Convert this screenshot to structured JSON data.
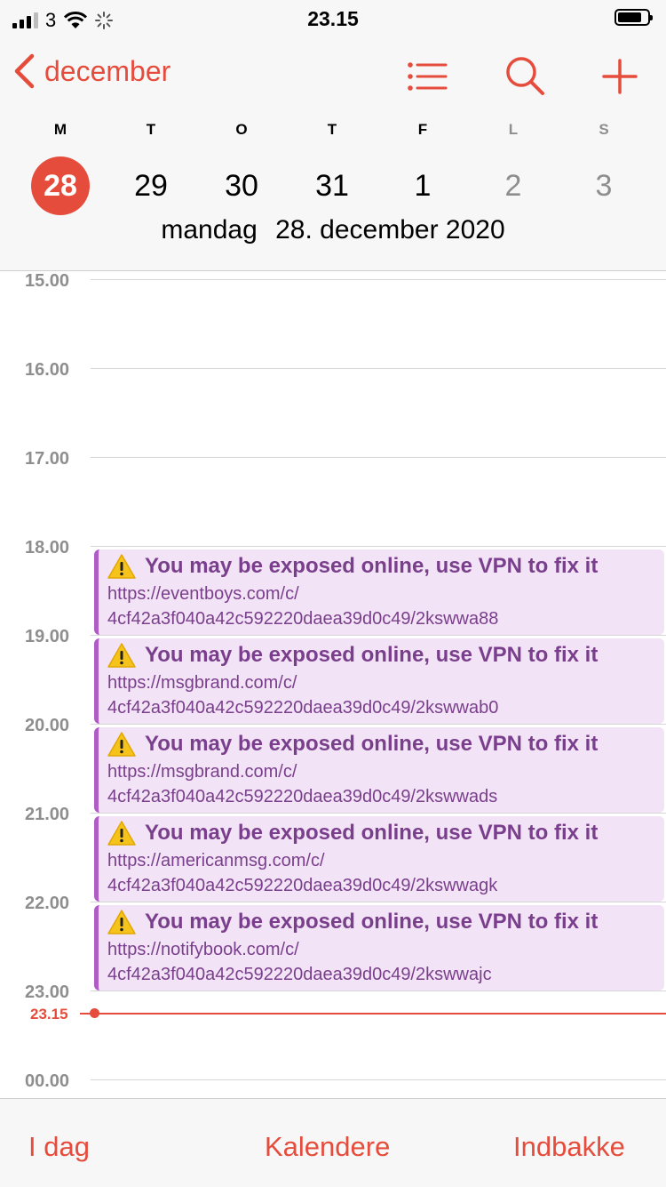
{
  "status_bar": {
    "carrier": "3",
    "time": "23.15"
  },
  "header": {
    "back_label": "december",
    "icons": [
      "list-icon",
      "search-icon",
      "plus-icon"
    ],
    "accent_color": "#e64c3c",
    "week": [
      {
        "letter": "M",
        "number": "28",
        "selected": true
      },
      {
        "letter": "T",
        "number": "29"
      },
      {
        "letter": "O",
        "number": "30"
      },
      {
        "letter": "T",
        "number": "31"
      },
      {
        "letter": "F",
        "number": "1"
      },
      {
        "letter": "L",
        "number": "2",
        "weekend": true
      },
      {
        "letter": "S",
        "number": "3",
        "weekend": true
      }
    ],
    "date_weekday": "mandag",
    "date_full": "28. december 2020"
  },
  "timeline": {
    "hours": [
      "15.00",
      "16.00",
      "17.00",
      "18.00",
      "19.00",
      "20.00",
      "21.00",
      "22.00",
      "23.00",
      "00.00"
    ],
    "current_time": "23.15",
    "event_color": "#b05cc6",
    "events": [
      {
        "title": "You may be exposed online, use VPN to fix it",
        "url_line1": "https://eventboys.com/c/",
        "url_line2": "4cf42a3f040a42c592220daea39d0c49/2kswwa88"
      },
      {
        "title": "You may be exposed online, use VPN to fix it",
        "url_line1": "https://msgbrand.com/c/",
        "url_line2": "4cf42a3f040a42c592220daea39d0c49/2kswwab0"
      },
      {
        "title": "You may be exposed online, use VPN to fix it",
        "url_line1": "https://msgbrand.com/c/",
        "url_line2": "4cf42a3f040a42c592220daea39d0c49/2kswwads"
      },
      {
        "title": "You may be exposed online, use VPN to fix it",
        "url_line1": "https://americanmsg.com/c/",
        "url_line2": "4cf42a3f040a42c592220daea39d0c49/2kswwagk"
      },
      {
        "title": "You may be exposed online, use VPN to fix it",
        "url_line1": "https://notifybook.com/c/",
        "url_line2": "4cf42a3f040a42c592220daea39d0c49/2kswwajc"
      }
    ]
  },
  "tabbar": {
    "today": "I dag",
    "calendars": "Kalendere",
    "inbox": "Indbakke"
  }
}
